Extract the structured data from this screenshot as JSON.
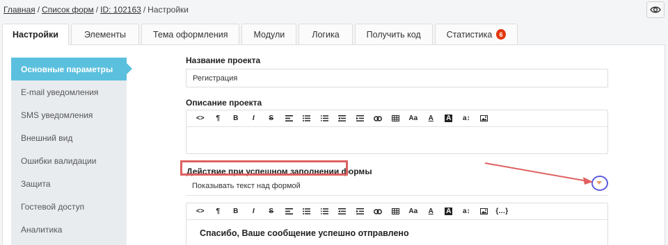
{
  "breadcrumb": {
    "home": "Главная",
    "forms": "Список форм",
    "id": "ID: 102163",
    "current": "Настройки",
    "separator": "/"
  },
  "tabs": [
    {
      "label": "Настройки"
    },
    {
      "label": "Элементы"
    },
    {
      "label": "Тема оформления"
    },
    {
      "label": "Модули"
    },
    {
      "label": "Логика"
    },
    {
      "label": "Получить код"
    },
    {
      "label": "Статистика",
      "badge": "6"
    }
  ],
  "sidebar": {
    "items": [
      {
        "label": "Основные параметры"
      },
      {
        "label": "E-mail уведомления"
      },
      {
        "label": "SMS уведомления"
      },
      {
        "label": "Внешний вид"
      },
      {
        "label": "Ошибки валидации"
      },
      {
        "label": "Защита"
      },
      {
        "label": "Гостевой доступ"
      },
      {
        "label": "Аналитика"
      }
    ]
  },
  "form": {
    "name_label": "Название проекта",
    "name_value": "Регистрация",
    "desc_label": "Описание проекта",
    "action_label": "Действие при успешном заполнении формы",
    "action_value": "Показывать текст над формой",
    "success_message": "Спасибо, Ваше сообщение успешно отправлено"
  },
  "toolbar1": [
    "<>",
    "¶",
    "B",
    "I",
    "S",
    "align",
    "ul",
    "ol",
    "outdent",
    "indent",
    "link",
    "table",
    "Aa",
    "A",
    "A",
    "a↕",
    "image"
  ],
  "toolbar2": [
    "<>",
    "¶",
    "B",
    "I",
    "S",
    "align",
    "ul",
    "ol",
    "outdent",
    "indent",
    "link",
    "table",
    "Aa",
    "A",
    "A",
    "a↕",
    "image",
    "{…}"
  ],
  "colors": {
    "accent": "#5bc0de",
    "badge": "#e2370e",
    "highlight": "#e06060",
    "arrow": "#e06060",
    "circle": "#5a5adc"
  }
}
